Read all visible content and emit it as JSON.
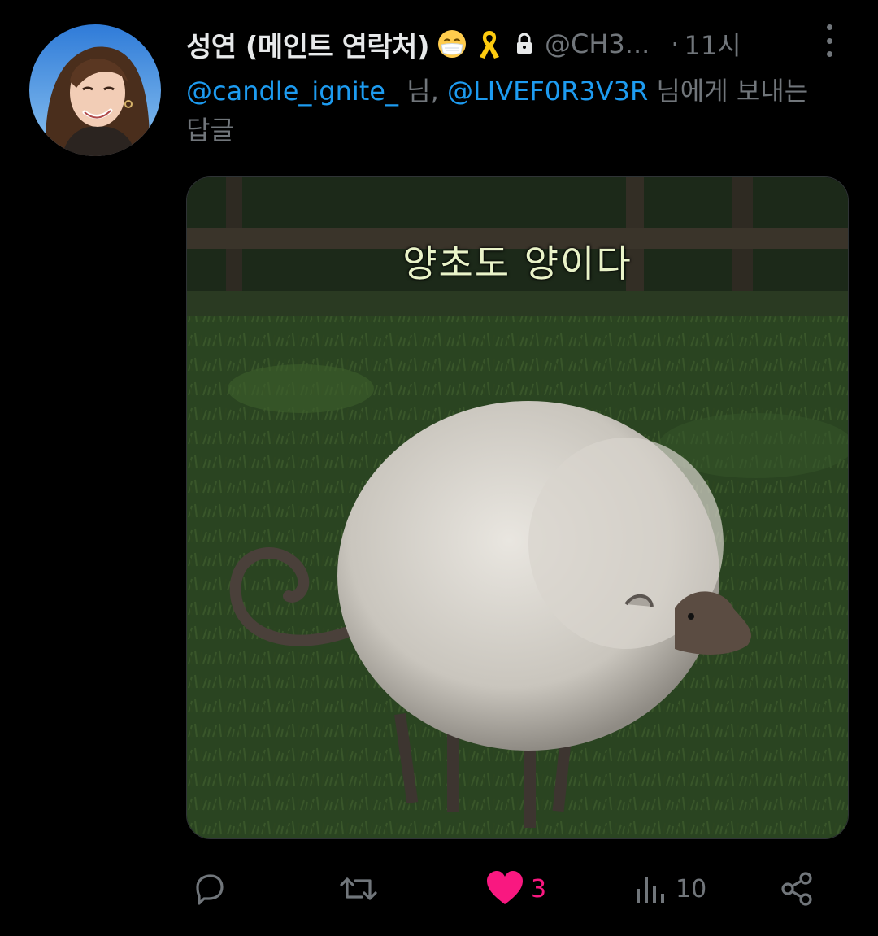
{
  "author": {
    "display_name": "성연 (메인트 연락처)",
    "handle": "@CH3...",
    "separator": "·",
    "time": "11시",
    "emoji_names": [
      "mask-face-emoji",
      "yellow-ribbon-emoji"
    ],
    "protected_icon": "lock-icon"
  },
  "reply": {
    "mention_1": "@candle_ignite_",
    "text_1": " 님, ",
    "mention_2": "@LIVEF0R3V3R",
    "text_2": " 님에게 보내는 답글"
  },
  "media": {
    "caption": "양초도 양이다"
  },
  "actions": {
    "reply_count": "",
    "retweet_count": "",
    "like_count": "3",
    "views_count": "10",
    "icons": [
      "reply-icon",
      "retweet-icon",
      "heart-icon",
      "views-icon",
      "share-icon"
    ]
  },
  "colors": {
    "background": "#000000",
    "primary_text": "#e7e9ea",
    "secondary_text": "#71767b",
    "link": "#1d9bf0",
    "like": "#f91880"
  }
}
